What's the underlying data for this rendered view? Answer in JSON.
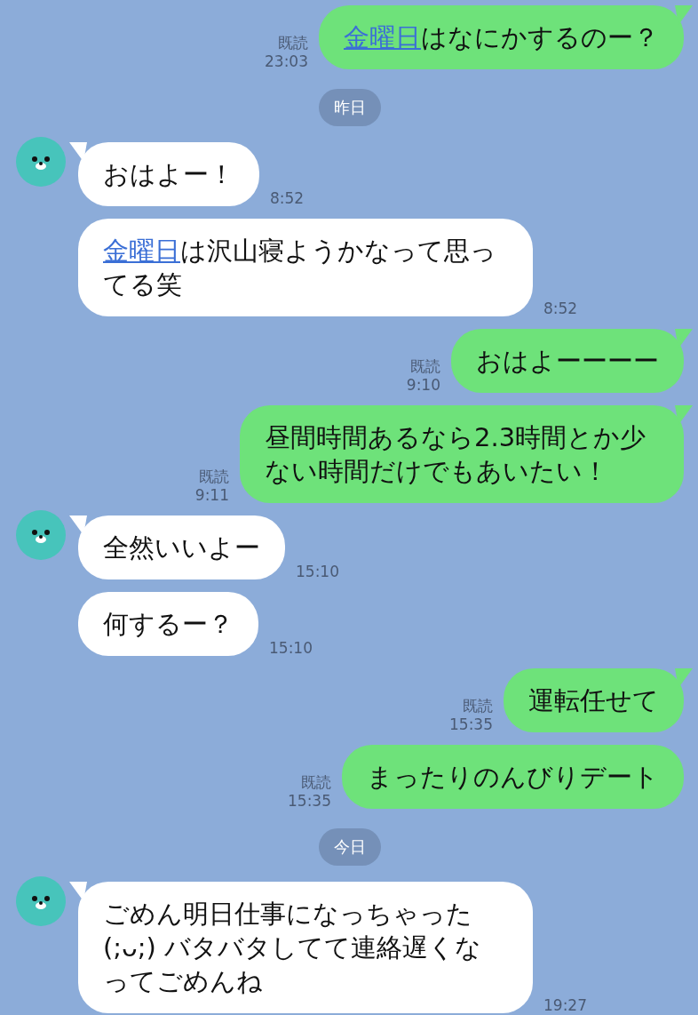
{
  "messages": [
    {
      "kind": "sent",
      "tail": true,
      "read": "既読",
      "time": "23:03",
      "parts": [
        {
          "text": "金曜日",
          "link": true
        },
        {
          "text": "はなにかするのー？",
          "link": false
        }
      ]
    },
    {
      "kind": "date",
      "label": "昨日"
    },
    {
      "kind": "received",
      "tail": true,
      "time": "8:52",
      "parts": [
        {
          "text": "おはよー！",
          "link": false
        }
      ]
    },
    {
      "kind": "received",
      "tail": false,
      "time": "8:52",
      "parts": [
        {
          "text": "金曜日",
          "link": true
        },
        {
          "text": "は沢山寝ようかなって思ってる笑",
          "link": false
        }
      ]
    },
    {
      "kind": "sent",
      "tail": true,
      "read": "既読",
      "time": "9:10",
      "parts": [
        {
          "text": "おはよーーーー",
          "link": false
        }
      ]
    },
    {
      "kind": "sent",
      "tail": true,
      "read": "既読",
      "time": "9:11",
      "parts": [
        {
          "text": "昼間時間あるなら2.3時間とか少ない時間だけでもあいたい！",
          "link": false
        }
      ]
    },
    {
      "kind": "received",
      "tail": true,
      "time": "15:10",
      "parts": [
        {
          "text": "全然いいよー",
          "link": false
        }
      ]
    },
    {
      "kind": "received",
      "tail": false,
      "time": "15:10",
      "parts": [
        {
          "text": "何するー？",
          "link": false
        }
      ]
    },
    {
      "kind": "sent",
      "tail": true,
      "read": "既読",
      "time": "15:35",
      "parts": [
        {
          "text": "運転任せて",
          "link": false
        }
      ]
    },
    {
      "kind": "sent",
      "tail": false,
      "read": "既読",
      "time": "15:35",
      "parts": [
        {
          "text": "まったりのんびりデート",
          "link": false
        }
      ]
    },
    {
      "kind": "date",
      "label": "今日"
    },
    {
      "kind": "received",
      "tail": true,
      "time": "19:27",
      "parts": [
        {
          "text": "ごめん明日仕事になっちゃった(;ᴗ;) バタバタしてて連絡遅くなってごめんね",
          "link": false
        }
      ]
    }
  ]
}
